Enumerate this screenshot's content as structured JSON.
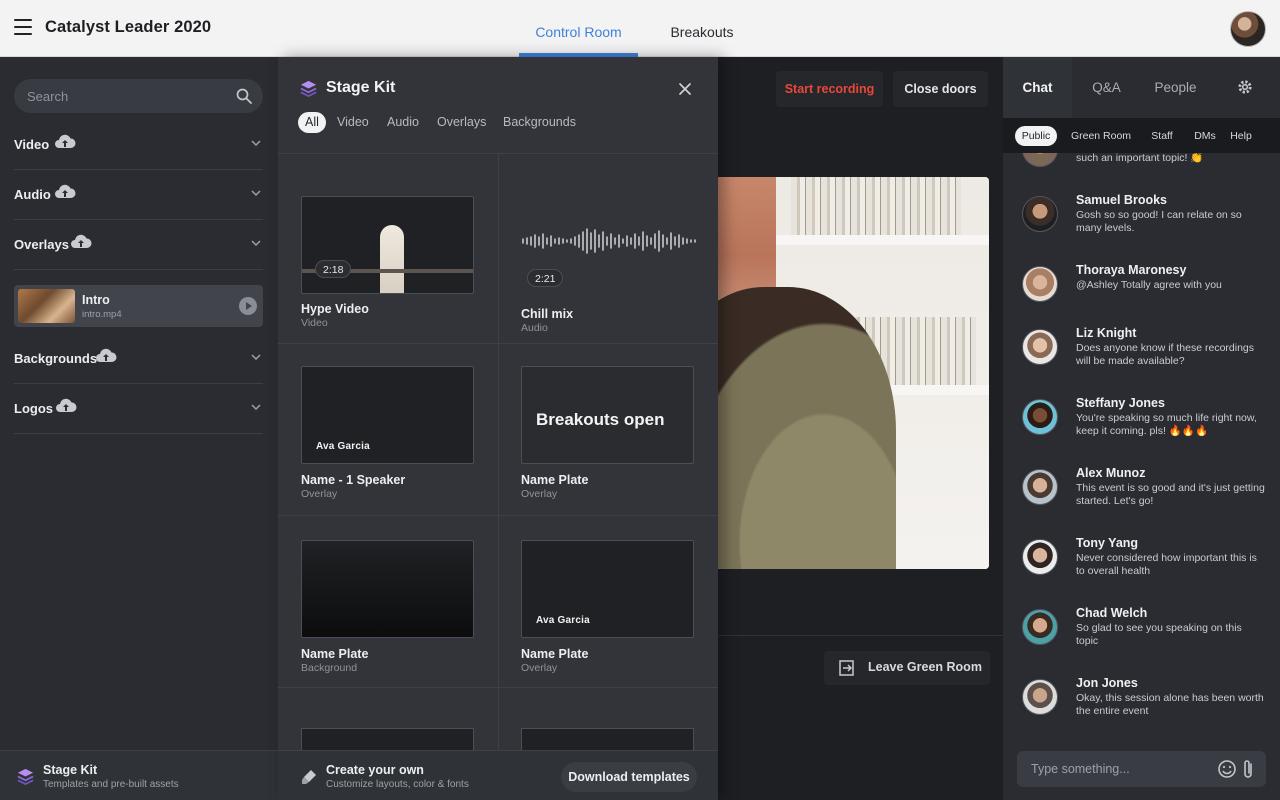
{
  "header": {
    "app_title": "Catalyst Leader 2020",
    "tabs": [
      {
        "label": "Control Room",
        "active": true
      },
      {
        "label": "Breakouts",
        "active": false
      }
    ],
    "accent_color": "#3d83d9"
  },
  "left_panel": {
    "search_placeholder": "Search",
    "categories": [
      {
        "label": "Video",
        "icon": "upload-cloud-icon"
      },
      {
        "label": "Audio",
        "icon": "upload-cloud-icon"
      },
      {
        "label": "Overlays",
        "icon": "upload-cloud-icon"
      },
      {
        "label": "Backgrounds",
        "icon": "upload-cloud-icon"
      },
      {
        "label": "Logos",
        "icon": "upload-cloud-icon"
      }
    ],
    "intro_item": {
      "title": "Intro",
      "file": "intro.mp4",
      "icon": "play-icon"
    },
    "footer": {
      "title": "Stage Kit",
      "subtitle": "Templates and pre-built assets"
    }
  },
  "stage_kit": {
    "title": "Stage Kit",
    "filters": [
      "All",
      "Video",
      "Audio",
      "Overlays",
      "Backgrounds"
    ],
    "active_filter": "All",
    "tiles": [
      {
        "name": "Hype Video",
        "type": "Video",
        "duration": "2:18"
      },
      {
        "name": "Chill mix",
        "type": "Audio",
        "duration": "2:21"
      },
      {
        "name": "Name - 1 Speaker",
        "type": "Overlay",
        "thumb_text": "Ava Garcia"
      },
      {
        "name": "Name Plate",
        "type": "Overlay",
        "thumb_text": "Breakouts open"
      },
      {
        "name": "Name Plate",
        "type": "Background"
      },
      {
        "name": "Name Plate",
        "type": "Overlay",
        "thumb_text": "Ava Garcia"
      }
    ],
    "footer": {
      "title": "Create your own",
      "subtitle": "Customize layouts, color & fonts",
      "button": "Download templates"
    }
  },
  "stage": {
    "start_recording": "Start recording",
    "close_doors": "Close doors",
    "leave_green_room": "Leave Green Room",
    "recording_color": "#e8473a"
  },
  "chat": {
    "tabs": [
      "Chat",
      "Q&A",
      "People"
    ],
    "active_tab": "Chat",
    "subtabs": [
      "Public",
      "Green Room",
      "Staff",
      "DMs",
      "Help"
    ],
    "active_subtab": "Public",
    "partial_message": "such an important topic! 👏",
    "messages": [
      {
        "name": "Samuel Brooks",
        "text": "Gosh so so good! I can relate on so many levels."
      },
      {
        "name": "Thoraya Maronesy",
        "text": "@Ashley Totally agree with you"
      },
      {
        "name": "Liz Knight",
        "text": "Does anyone know if these recordings will be made available?"
      },
      {
        "name": "Steffany Jones",
        "text": "You're speaking so much life right now, keep it coming. pls! 🔥🔥🔥"
      },
      {
        "name": "Alex Munoz",
        "text": "This event is so good and it's just getting started. Let's go!"
      },
      {
        "name": "Tony Yang",
        "text": "Never considered how important this is to overall health"
      },
      {
        "name": "Chad Welch",
        "text": "So glad to see you speaking on this topic"
      },
      {
        "name": "Jon Jones",
        "text": "Okay, this session alone has been worth the entire event"
      }
    ],
    "input_placeholder": "Type something..."
  }
}
